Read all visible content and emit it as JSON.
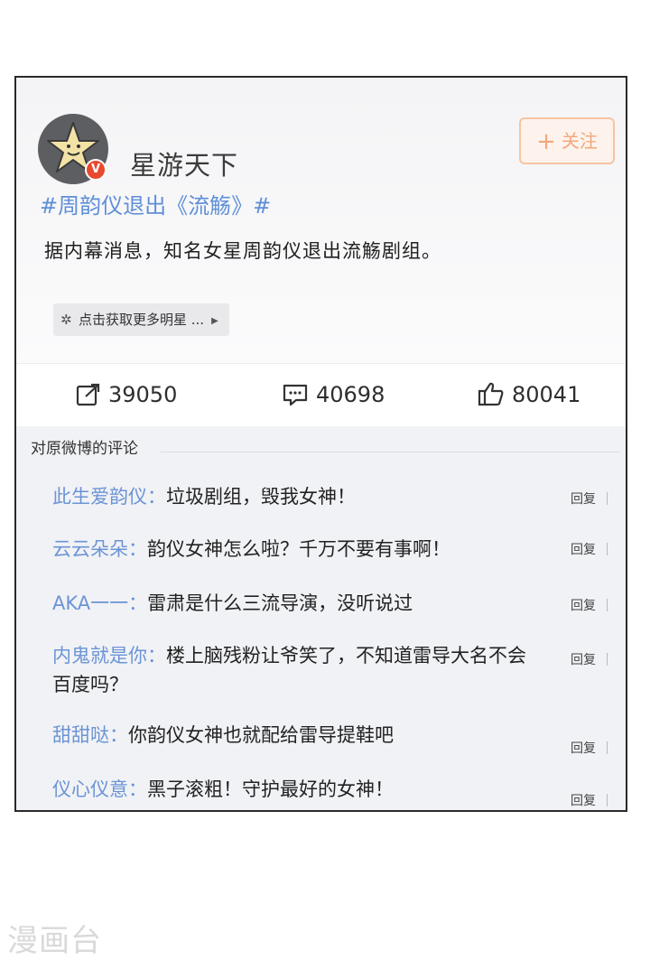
{
  "post": {
    "author": "星游天下",
    "verified_badge": "V",
    "follow_label": "关注",
    "hashtag": "#周韵仪退出《流觞》#",
    "text": "据内幕消息，知名女星周韵仪退出流觞剧组。",
    "more_chip_label": "点击获取更多明星 ..."
  },
  "actions": {
    "share_count": "39050",
    "comment_count": "40698",
    "like_count": "80041"
  },
  "comments": {
    "header": "对原微博的评论",
    "reply_label": "回复",
    "items": [
      {
        "user": "此生爱韵仪：",
        "text": "垃圾剧组，毁我女神！"
      },
      {
        "user": "云云朵朵：",
        "text": "韵仪女神怎么啦？千万不要有事啊！"
      },
      {
        "user": "AKA一一：",
        "text": "雷肃是什么三流导演，没听说过"
      },
      {
        "user": "内鬼就是你：",
        "text": "楼上脑残粉让爷笑了，不知道雷导大名不会百度吗？"
      },
      {
        "user": "甜甜哒：",
        "text": "你韵仪女神也就配给雷导提鞋吧"
      },
      {
        "user": "仪心仪意：",
        "text": "黑子滚粗！守护最好的女神！"
      }
    ]
  },
  "watermark": "漫画台",
  "colors": {
    "link_blue": "#5f8fd7",
    "follow_orange": "#f2a77b",
    "verified_red": "#e8492f"
  },
  "icons": {
    "avatar": "star-avatar-icon",
    "share": "share-icon",
    "comment": "comment-icon",
    "like": "thumbs-up-icon",
    "chip": "sparkle-icon"
  }
}
